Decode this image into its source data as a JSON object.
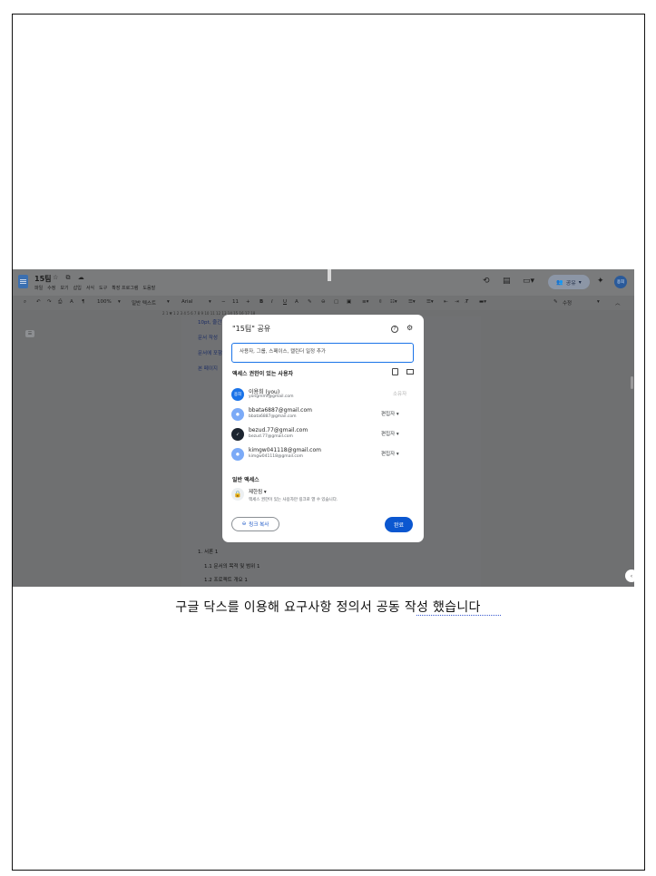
{
  "doc": {
    "title": "15팀",
    "title_icons": "☆ ⧉ ☁",
    "menu": [
      "파일",
      "수정",
      "보기",
      "삽입",
      "서식",
      "도구",
      "확장 프로그램",
      "도움말"
    ],
    "share_label": "공유",
    "user_initials": "용희",
    "toolbar": {
      "zoom": "100%",
      "style": "일반 텍스트",
      "font": "Arial",
      "font_size": "11",
      "edit_mode": "수정"
    },
    "ruler": "2   1   ▼  1   2   3   4   5   6   7   8   9   10   11   12   13   14   15   16   17   18",
    "body_lines": [
      "10pt, 줄간",
      "문서 작성",
      "문서에 포함",
      "본 페이지"
    ],
    "outline_lines": [
      "1. 서론 1",
      "1.1 문서의 목적 및 범위 1",
      "1.2 프로젝트 개요 1"
    ]
  },
  "dialog": {
    "title": "\"15팀\" 공유",
    "input_placeholder": "사용자, 그룹, 스페이스, 캘린더 일정 추가",
    "people_header": "액세스 권한이 있는 사용자",
    "people": [
      {
        "name": "이용희 (you)",
        "email": "yongmmf@gmail.com",
        "role": "소유자",
        "avatar": "용희",
        "color": "#1a73e8"
      },
      {
        "name": "bbata6887@gmail.com",
        "email": "bbata6887@gmail.com",
        "role": "편집자 ▾",
        "avatar": "",
        "color": "#7baaf7"
      },
      {
        "name": "bezud.77@gmail.com",
        "email": "bezud.77@gmail.com",
        "role": "편집자 ▾",
        "avatar": "",
        "color": "#1c2530"
      },
      {
        "name": "kimgw041118@gmail.com",
        "email": "kimgw041118@gmail.com",
        "role": "편집자 ▾",
        "avatar": "",
        "color": "#7baaf7"
      }
    ],
    "general_header": "일반 액세스",
    "general_label": "제한됨 ▾",
    "general_desc": "액세스 권한이 있는 사용자만 링크로 열 수 있습니다.",
    "copy_link": "링크 복사",
    "done": "완료"
  },
  "caption": "구글 닥스를 이용해 요구사항 정의서 공동 작성 했습니다"
}
